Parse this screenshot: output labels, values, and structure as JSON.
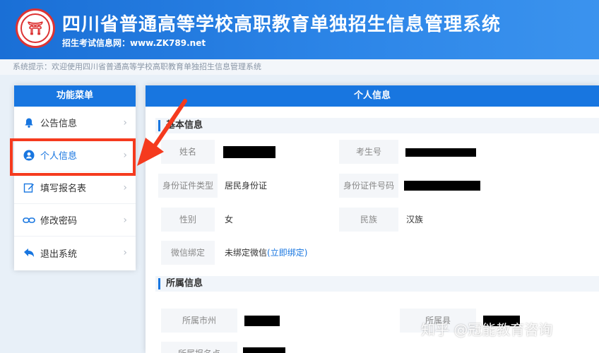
{
  "header": {
    "title": "四川省普通高等学校高职教育单独招生信息管理系统",
    "subtitle": "招生考试信息网：www.ZK789.net"
  },
  "notice": "系统提示：欢迎使用四川省普通高等学校高职教育单独招生信息管理系统",
  "menu": {
    "title": "功能菜单",
    "items": [
      {
        "label": "公告信息",
        "icon": "bell-icon"
      },
      {
        "label": "个人信息",
        "icon": "user-icon"
      },
      {
        "label": "填写报名表",
        "icon": "edit-icon"
      },
      {
        "label": "修改密码",
        "icon": "link-icon"
      },
      {
        "label": "退出系统",
        "icon": "back-icon"
      }
    ]
  },
  "panel": {
    "title": "个人信息",
    "basic_title": "基本信息",
    "fields": {
      "name_label": "姓名",
      "exam_no_label": "考生号",
      "id_type_label": "身份证件类型",
      "id_type_value": "居民身份证",
      "id_no_label": "身份证件号码",
      "gender_label": "性别",
      "gender_value": "女",
      "ethnic_label": "民族",
      "ethnic_value": "汉族",
      "wechat_label": "微信绑定",
      "wechat_value": "未绑定微信",
      "wechat_link": "(立即绑定)"
    },
    "affil_title": "所属信息",
    "affil": {
      "city_label": "所属市州",
      "county_label": "所属县",
      "site_label": "所属报名点"
    }
  },
  "watermark": "知乎 @冠能教育咨询",
  "colors": {
    "primary": "#1876e0",
    "highlight": "#f53a1e"
  }
}
